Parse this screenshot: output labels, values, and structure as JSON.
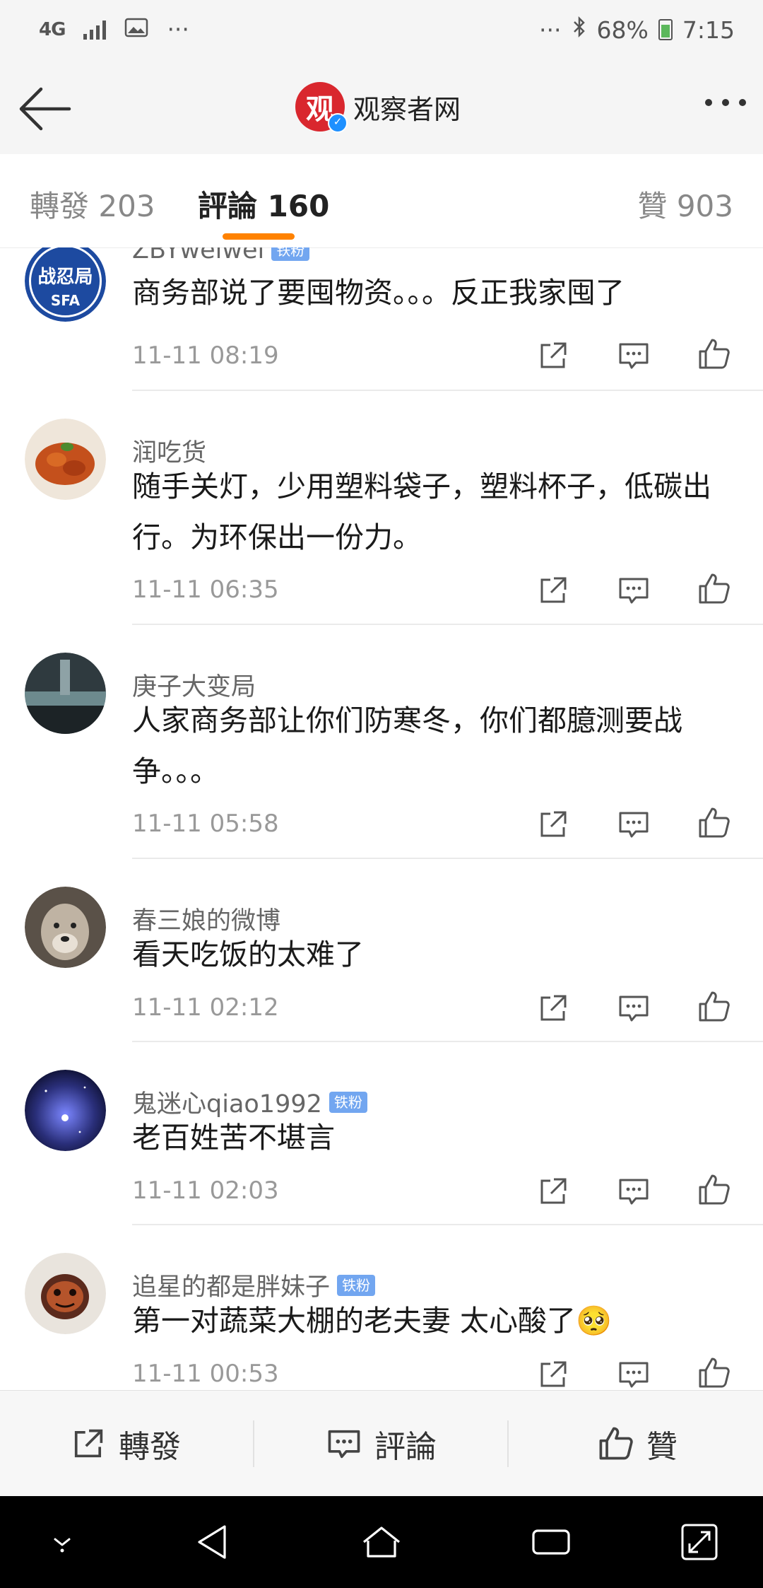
{
  "status_bar": {
    "network": "4G",
    "more": "···",
    "right_more": "···",
    "battery": "68%",
    "time": "7:15"
  },
  "header": {
    "logo_char": "观",
    "title": "观察者网",
    "verified_mark": "✓"
  },
  "tabs": {
    "repost": "轉發 203",
    "comments": "評論 160",
    "likes": "贊 903"
  },
  "comments": [
    {
      "username": "ZBYweiwei",
      "badge": "铁粉",
      "text": "商务部说了要囤物资。。。反正我家囤了",
      "time": "11-11 08:19",
      "avatar_text": "战忍局",
      "avatar_sub": "SFA"
    },
    {
      "username": "润吃货",
      "badge": "",
      "text": "随手关灯，少用塑料袋子，塑料杯子，低碳出行。为环保出一份力。",
      "time": "11-11 06:35"
    },
    {
      "username": "庚子大变局",
      "badge": "",
      "text": "人家商务部让你们防寒冬，你们都臆测要战争。。。",
      "time": "11-11 05:58"
    },
    {
      "username": "春三娘的微博",
      "badge": "",
      "text": "看天吃饭的太难了",
      "time": "11-11 02:12"
    },
    {
      "username": "鬼迷心qiao1992",
      "badge": "铁粉",
      "text": "老百姓苦不堪言",
      "time": "11-11 02:03"
    },
    {
      "username": "追星的都是胖妹子",
      "badge": "铁粉",
      "text": "第一对蔬菜大棚的老夫妻 太心酸了",
      "time": "11-11 00:53",
      "emoji": "🥺"
    }
  ],
  "toolbar": {
    "repost": "轉發",
    "comment": "評論",
    "like": "贊"
  },
  "colors": {
    "accent": "#ff8200",
    "badge": "#72a6f0",
    "logo": "#d9272e"
  }
}
